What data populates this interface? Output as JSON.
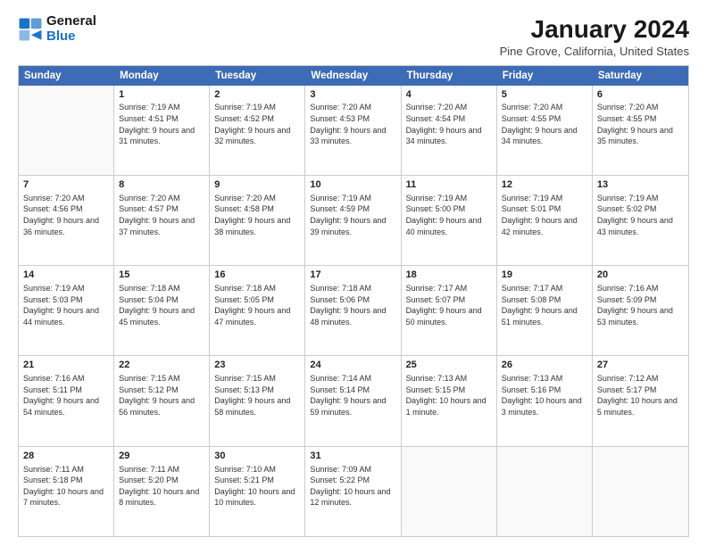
{
  "logo": {
    "text_general": "General",
    "text_blue": "Blue"
  },
  "title": "January 2024",
  "subtitle": "Pine Grove, California, United States",
  "header_days": [
    "Sunday",
    "Monday",
    "Tuesday",
    "Wednesday",
    "Thursday",
    "Friday",
    "Saturday"
  ],
  "weeks": [
    [
      {
        "day": "",
        "empty": true
      },
      {
        "day": "1",
        "sunrise": "Sunrise: 7:19 AM",
        "sunset": "Sunset: 4:51 PM",
        "daylight": "Daylight: 9 hours and 31 minutes."
      },
      {
        "day": "2",
        "sunrise": "Sunrise: 7:19 AM",
        "sunset": "Sunset: 4:52 PM",
        "daylight": "Daylight: 9 hours and 32 minutes."
      },
      {
        "day": "3",
        "sunrise": "Sunrise: 7:20 AM",
        "sunset": "Sunset: 4:53 PM",
        "daylight": "Daylight: 9 hours and 33 minutes."
      },
      {
        "day": "4",
        "sunrise": "Sunrise: 7:20 AM",
        "sunset": "Sunset: 4:54 PM",
        "daylight": "Daylight: 9 hours and 34 minutes."
      },
      {
        "day": "5",
        "sunrise": "Sunrise: 7:20 AM",
        "sunset": "Sunset: 4:55 PM",
        "daylight": "Daylight: 9 hours and 34 minutes."
      },
      {
        "day": "6",
        "sunrise": "Sunrise: 7:20 AM",
        "sunset": "Sunset: 4:55 PM",
        "daylight": "Daylight: 9 hours and 35 minutes."
      }
    ],
    [
      {
        "day": "7",
        "sunrise": "Sunrise: 7:20 AM",
        "sunset": "Sunset: 4:56 PM",
        "daylight": "Daylight: 9 hours and 36 minutes."
      },
      {
        "day": "8",
        "sunrise": "Sunrise: 7:20 AM",
        "sunset": "Sunset: 4:57 PM",
        "daylight": "Daylight: 9 hours and 37 minutes."
      },
      {
        "day": "9",
        "sunrise": "Sunrise: 7:20 AM",
        "sunset": "Sunset: 4:58 PM",
        "daylight": "Daylight: 9 hours and 38 minutes."
      },
      {
        "day": "10",
        "sunrise": "Sunrise: 7:19 AM",
        "sunset": "Sunset: 4:59 PM",
        "daylight": "Daylight: 9 hours and 39 minutes."
      },
      {
        "day": "11",
        "sunrise": "Sunrise: 7:19 AM",
        "sunset": "Sunset: 5:00 PM",
        "daylight": "Daylight: 9 hours and 40 minutes."
      },
      {
        "day": "12",
        "sunrise": "Sunrise: 7:19 AM",
        "sunset": "Sunset: 5:01 PM",
        "daylight": "Daylight: 9 hours and 42 minutes."
      },
      {
        "day": "13",
        "sunrise": "Sunrise: 7:19 AM",
        "sunset": "Sunset: 5:02 PM",
        "daylight": "Daylight: 9 hours and 43 minutes."
      }
    ],
    [
      {
        "day": "14",
        "sunrise": "Sunrise: 7:19 AM",
        "sunset": "Sunset: 5:03 PM",
        "daylight": "Daylight: 9 hours and 44 minutes."
      },
      {
        "day": "15",
        "sunrise": "Sunrise: 7:18 AM",
        "sunset": "Sunset: 5:04 PM",
        "daylight": "Daylight: 9 hours and 45 minutes."
      },
      {
        "day": "16",
        "sunrise": "Sunrise: 7:18 AM",
        "sunset": "Sunset: 5:05 PM",
        "daylight": "Daylight: 9 hours and 47 minutes."
      },
      {
        "day": "17",
        "sunrise": "Sunrise: 7:18 AM",
        "sunset": "Sunset: 5:06 PM",
        "daylight": "Daylight: 9 hours and 48 minutes."
      },
      {
        "day": "18",
        "sunrise": "Sunrise: 7:17 AM",
        "sunset": "Sunset: 5:07 PM",
        "daylight": "Daylight: 9 hours and 50 minutes."
      },
      {
        "day": "19",
        "sunrise": "Sunrise: 7:17 AM",
        "sunset": "Sunset: 5:08 PM",
        "daylight": "Daylight: 9 hours and 51 minutes."
      },
      {
        "day": "20",
        "sunrise": "Sunrise: 7:16 AM",
        "sunset": "Sunset: 5:09 PM",
        "daylight": "Daylight: 9 hours and 53 minutes."
      }
    ],
    [
      {
        "day": "21",
        "sunrise": "Sunrise: 7:16 AM",
        "sunset": "Sunset: 5:11 PM",
        "daylight": "Daylight: 9 hours and 54 minutes."
      },
      {
        "day": "22",
        "sunrise": "Sunrise: 7:15 AM",
        "sunset": "Sunset: 5:12 PM",
        "daylight": "Daylight: 9 hours and 56 minutes."
      },
      {
        "day": "23",
        "sunrise": "Sunrise: 7:15 AM",
        "sunset": "Sunset: 5:13 PM",
        "daylight": "Daylight: 9 hours and 58 minutes."
      },
      {
        "day": "24",
        "sunrise": "Sunrise: 7:14 AM",
        "sunset": "Sunset: 5:14 PM",
        "daylight": "Daylight: 9 hours and 59 minutes."
      },
      {
        "day": "25",
        "sunrise": "Sunrise: 7:13 AM",
        "sunset": "Sunset: 5:15 PM",
        "daylight": "Daylight: 10 hours and 1 minute."
      },
      {
        "day": "26",
        "sunrise": "Sunrise: 7:13 AM",
        "sunset": "Sunset: 5:16 PM",
        "daylight": "Daylight: 10 hours and 3 minutes."
      },
      {
        "day": "27",
        "sunrise": "Sunrise: 7:12 AM",
        "sunset": "Sunset: 5:17 PM",
        "daylight": "Daylight: 10 hours and 5 minutes."
      }
    ],
    [
      {
        "day": "28",
        "sunrise": "Sunrise: 7:11 AM",
        "sunset": "Sunset: 5:18 PM",
        "daylight": "Daylight: 10 hours and 7 minutes."
      },
      {
        "day": "29",
        "sunrise": "Sunrise: 7:11 AM",
        "sunset": "Sunset: 5:20 PM",
        "daylight": "Daylight: 10 hours and 8 minutes."
      },
      {
        "day": "30",
        "sunrise": "Sunrise: 7:10 AM",
        "sunset": "Sunset: 5:21 PM",
        "daylight": "Daylight: 10 hours and 10 minutes."
      },
      {
        "day": "31",
        "sunrise": "Sunrise: 7:09 AM",
        "sunset": "Sunset: 5:22 PM",
        "daylight": "Daylight: 10 hours and 12 minutes."
      },
      {
        "day": "",
        "empty": true
      },
      {
        "day": "",
        "empty": true
      },
      {
        "day": "",
        "empty": true
      }
    ]
  ]
}
